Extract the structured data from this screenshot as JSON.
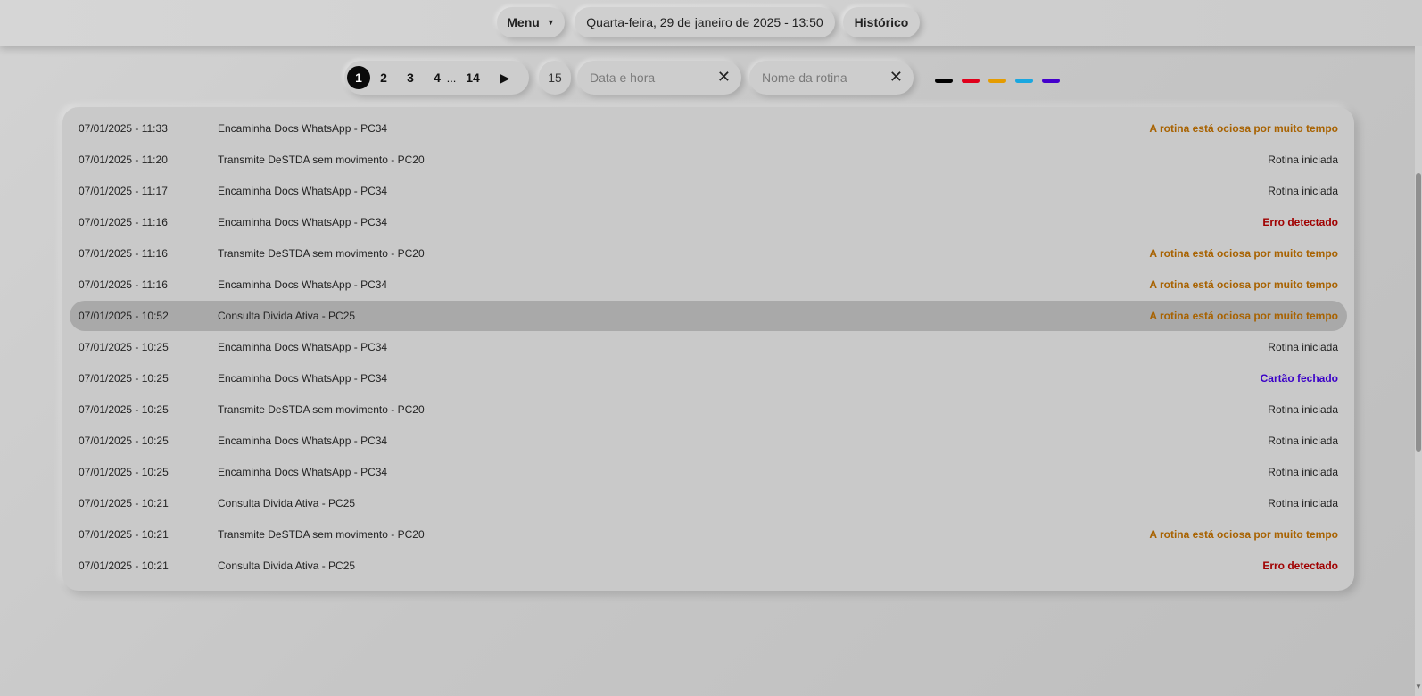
{
  "header": {
    "menu_label": "Menu",
    "datetime": "Quarta-feira, 29 de janeiro de 2025 - 13:50",
    "history_label": "Histórico"
  },
  "pagination": {
    "pages": [
      "1",
      "2",
      "3",
      "4",
      "14"
    ],
    "ellipsis": "...",
    "current": "1",
    "page_size": "15"
  },
  "filters": {
    "date_placeholder": "Data e hora",
    "name_placeholder": "Nome da rotina",
    "clear_symbol": "✕"
  },
  "color_legend": [
    "#000000",
    "#e0001b",
    "#e59c00",
    "#19a7e0",
    "#4400cc"
  ],
  "entries": [
    {
      "datetime": "07/01/2025 - 11:33",
      "routine": "Encaminha Docs WhatsApp - PC34",
      "status": "A rotina está ociosa por muito tempo",
      "kind": "warn"
    },
    {
      "datetime": "07/01/2025 - 11:20",
      "routine": "Transmite DeSTDA sem movimento - PC20",
      "status": "Rotina iniciada",
      "kind": "ok"
    },
    {
      "datetime": "07/01/2025 - 11:17",
      "routine": "Encaminha Docs WhatsApp - PC34",
      "status": "Rotina iniciada",
      "kind": "ok"
    },
    {
      "datetime": "07/01/2025 - 11:16",
      "routine": "Encaminha Docs WhatsApp - PC34",
      "status": "Erro detectado",
      "kind": "err"
    },
    {
      "datetime": "07/01/2025 - 11:16",
      "routine": "Transmite DeSTDA sem movimento - PC20",
      "status": "A rotina está ociosa por muito tempo",
      "kind": "warn"
    },
    {
      "datetime": "07/01/2025 - 11:16",
      "routine": "Encaminha Docs WhatsApp - PC34",
      "status": "A rotina está ociosa por muito tempo",
      "kind": "warn"
    },
    {
      "datetime": "07/01/2025 - 10:52",
      "routine": "Consulta Divida Ativa - PC25",
      "status": "A rotina está ociosa por muito tempo",
      "kind": "warn",
      "selected": true
    },
    {
      "datetime": "07/01/2025 - 10:25",
      "routine": "Encaminha Docs WhatsApp - PC34",
      "status": "Rotina iniciada",
      "kind": "ok"
    },
    {
      "datetime": "07/01/2025 - 10:25",
      "routine": "Encaminha Docs WhatsApp - PC34",
      "status": "Cartão fechado",
      "kind": "closed"
    },
    {
      "datetime": "07/01/2025 - 10:25",
      "routine": "Transmite DeSTDA sem movimento - PC20",
      "status": "Rotina iniciada",
      "kind": "ok"
    },
    {
      "datetime": "07/01/2025 - 10:25",
      "routine": "Encaminha Docs WhatsApp - PC34",
      "status": "Rotina iniciada",
      "kind": "ok"
    },
    {
      "datetime": "07/01/2025 - 10:25",
      "routine": "Encaminha Docs WhatsApp - PC34",
      "status": "Rotina iniciada",
      "kind": "ok"
    },
    {
      "datetime": "07/01/2025 - 10:21",
      "routine": "Consulta Divida Ativa - PC25",
      "status": "Rotina iniciada",
      "kind": "ok"
    },
    {
      "datetime": "07/01/2025 - 10:21",
      "routine": "Transmite DeSTDA sem movimento - PC20",
      "status": "A rotina está ociosa por muito tempo",
      "kind": "warn"
    },
    {
      "datetime": "07/01/2025 - 10:21",
      "routine": "Consulta Divida Ativa - PC25",
      "status": "Erro detectado",
      "kind": "err"
    }
  ]
}
